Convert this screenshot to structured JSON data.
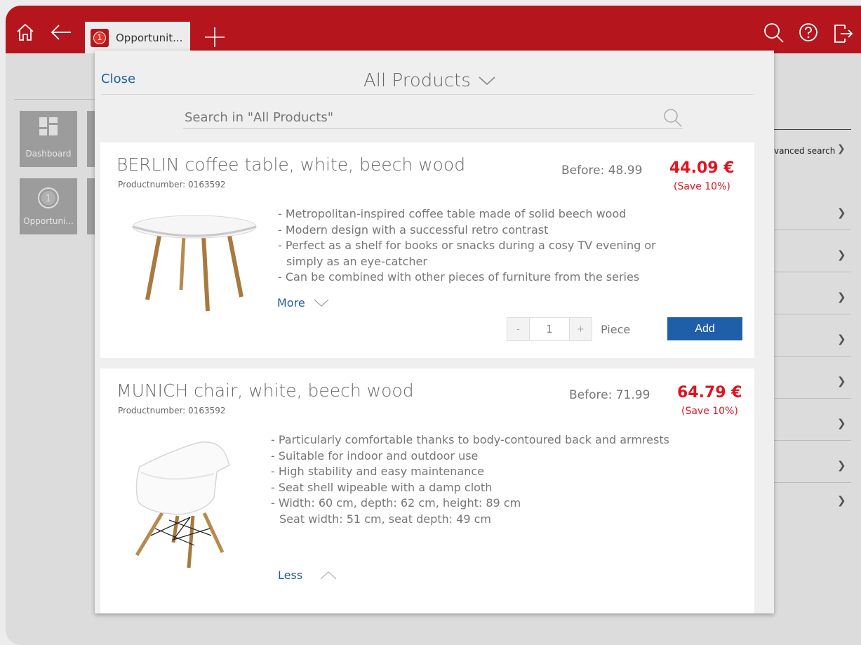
{
  "colors": {
    "brand": "#b5161d",
    "link": "#1f5ea8",
    "price": "#e2131f",
    "add_button": "#1f5ea8"
  },
  "topbar": {
    "icons": [
      "home-icon",
      "back-arrow-icon",
      "plus-icon",
      "search-icon",
      "help-icon",
      "logout-icon"
    ],
    "tab": {
      "badge": "1",
      "label": "Opportunit..."
    }
  },
  "background": {
    "tiles": [
      {
        "label": "Dashboard"
      },
      {
        "label": "Opportuni..."
      }
    ],
    "right_panel": {
      "advanced": "vanced search"
    }
  },
  "modal": {
    "close_label": "Close",
    "title": "All Products",
    "search_placeholder": "Search in \"All Products\"",
    "products": [
      {
        "name": "BERLIN coffee table, white, beech wood",
        "number": "Productnumber: 0163592",
        "before": "Before: 48.99",
        "price": "44.09 €",
        "save": "(Save 10%)",
        "description": [
          "- Metropolitan-inspired coffee table made of solid beech wood",
          "- Modern design with a successful retro contrast",
          "- Perfect as a shelf for books or snacks during a cosy TV evening or",
          "simply as an eye-catcher",
          "- Can be combined with other pieces of furniture from the series"
        ],
        "toggle": "More",
        "quantity": {
          "minus": "-",
          "value": "1",
          "plus": "+"
        },
        "unit": "Piece",
        "add_label": "Add"
      },
      {
        "name": "MUNICH chair, white, beech wood",
        "number": "Productnumber: 0163592",
        "before": "Before: 71.99",
        "price": "64.79 €",
        "save": "(Save 10%)",
        "description": [
          "- Particularly comfortable thanks to body-contoured back and armrests",
          "- Suitable for indoor and outdoor use",
          "- High stability and easy maintenance",
          "- Seat shell wipeable with a damp cloth",
          "- Width: 60 cm, depth: 62 cm, height: 89 cm",
          "Seat width: 51 cm, seat depth: 49 cm"
        ],
        "toggle": "Less"
      }
    ]
  }
}
